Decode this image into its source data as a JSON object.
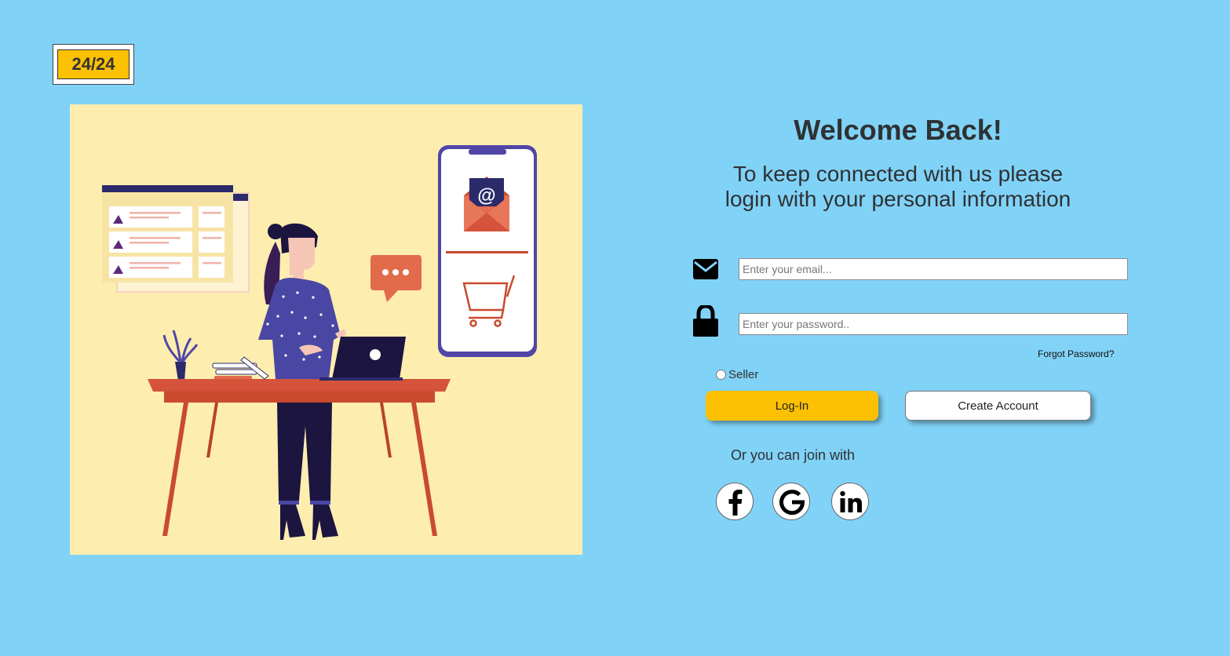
{
  "brand": {
    "logo_text": "24/24"
  },
  "login": {
    "title": "Welcome Back!",
    "subtitle_line1": "To keep connected with us please",
    "subtitle_line2": "login with your personal information",
    "email_placeholder": "Enter your email...",
    "password_placeholder": "Enter your password..",
    "forgot_label": "Forgot Password?",
    "seller_label": "Seller",
    "login_button": "Log-In",
    "create_button": "Create Account",
    "join_text": "Or you can join with"
  },
  "social": [
    "facebook-icon",
    "google-icon",
    "linkedin-icon"
  ],
  "illustration": {
    "email_glyph": "@",
    "icons": [
      "envelope-icon",
      "shopping-cart-icon",
      "chat-bubble-icon",
      "laptop-icon",
      "plant-icon"
    ]
  },
  "colors": {
    "background": "#81d2f7",
    "accent": "#fcc102",
    "illustration_bg": "#fdedaf",
    "text": "#2f3133"
  }
}
